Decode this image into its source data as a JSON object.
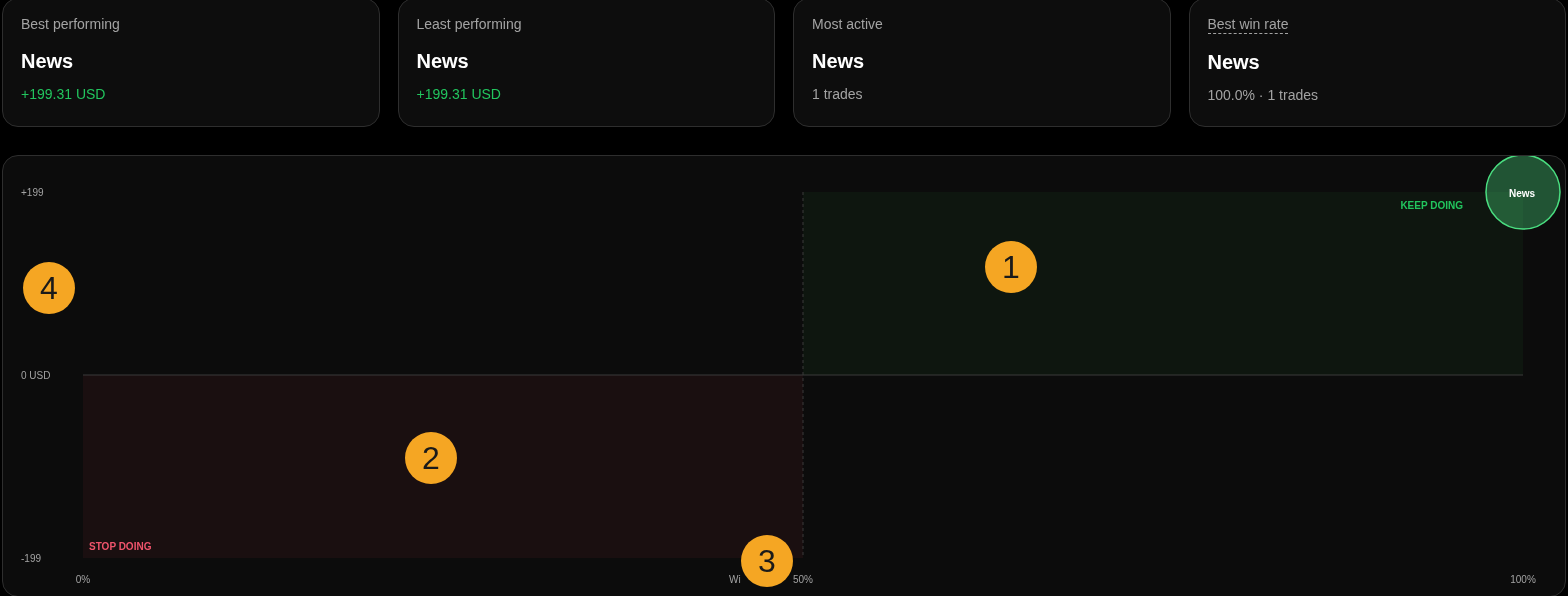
{
  "cards": [
    {
      "label": "Best performing",
      "label_dashed": false,
      "value": "News",
      "detail": "+199.31 USD",
      "positive": true
    },
    {
      "label": "Least performing",
      "label_dashed": false,
      "value": "News",
      "detail": "+199.31 USD",
      "positive": true
    },
    {
      "label": "Most active",
      "label_dashed": false,
      "value": "News",
      "detail": "1 trades",
      "positive": false
    },
    {
      "label": "Best win rate",
      "label_dashed": true,
      "value": "News",
      "detail": "100.0% · 1 trades",
      "positive": false
    }
  ],
  "quadrant_chart": {
    "chart_data": {
      "type": "scatter",
      "xlabel": "Wi",
      "xlim": [
        0,
        100
      ],
      "ylim": [
        -199,
        199
      ],
      "xticks": [
        {
          "value": 0,
          "label": "0%"
        },
        {
          "value": 50,
          "label": "50%"
        },
        {
          "value": 100,
          "label": "100%"
        }
      ],
      "yticks": [
        {
          "value": 199,
          "label": "+199"
        },
        {
          "value": 0,
          "label": "0 USD"
        },
        {
          "value": -199,
          "label": "-199"
        }
      ],
      "series": [
        {
          "name": "News",
          "color": "#4ade80",
          "x": [
            100
          ],
          "values": [
            199
          ]
        }
      ],
      "ref_lines": [
        {
          "axis": "x",
          "value": 50
        },
        {
          "axis": "y",
          "value": 0
        }
      ],
      "annotations": [
        "KEEP DOING",
        "STOP DOING"
      ]
    }
  },
  "callouts": [
    "1",
    "2",
    "3",
    "4"
  ]
}
